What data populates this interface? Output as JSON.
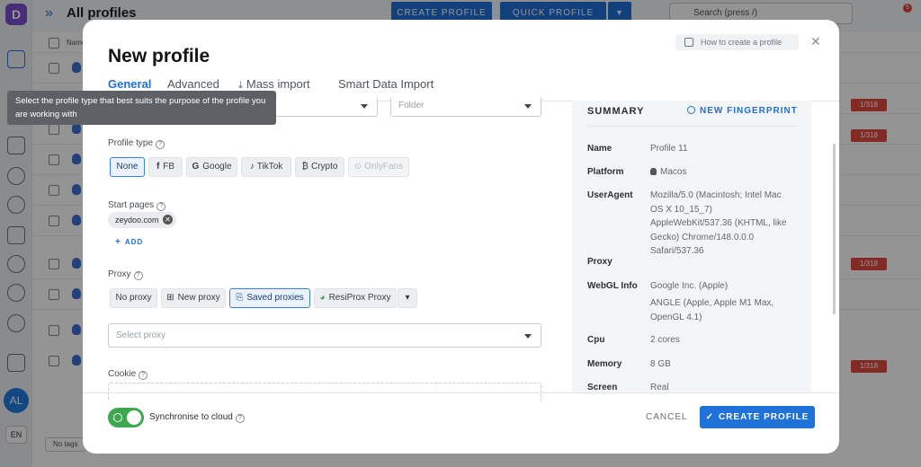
{
  "app": {
    "logo_letter": "D",
    "title": "All profiles",
    "create_profile_btn": "CREATE PROFILE",
    "quick_profile_btn": "QUICK PROFILE",
    "search_placeholder": "Search (press /)",
    "notification_count": "5",
    "user_initials": "AL",
    "language": "EN",
    "column_name": "Name",
    "limit_badge": "1/318",
    "tags_filter": "No tags"
  },
  "modal": {
    "title": "New profile",
    "how_to": "How to create a profile",
    "tabs": [
      {
        "label": "General",
        "active": true
      },
      {
        "label": "Advanced",
        "active": false
      },
      {
        "label": "Mass import",
        "active": false
      },
      {
        "label": "Smart Data Import",
        "active": false
      }
    ],
    "folder_placeholder": "Folder",
    "tooltip": "Select the profile type that best suits the purpose of the profile you are working with",
    "profile_type": {
      "label": "Profile type",
      "options": [
        {
          "label": "None",
          "icon": "",
          "selected": true,
          "disabled": false
        },
        {
          "label": "FB",
          "icon": "f",
          "selected": false,
          "disabled": false
        },
        {
          "label": "Google",
          "icon": "G",
          "selected": false,
          "disabled": false
        },
        {
          "label": "TikTok",
          "icon": "♪",
          "selected": false,
          "disabled": false
        },
        {
          "label": "Crypto",
          "icon": "₿",
          "selected": false,
          "disabled": false
        },
        {
          "label": "OnlyFans",
          "icon": "⊙",
          "selected": false,
          "disabled": true
        }
      ]
    },
    "start_pages": {
      "label": "Start pages",
      "chips": [
        "zeydoo.com"
      ],
      "add_label": "ADD"
    },
    "proxy": {
      "label": "Proxy",
      "options": [
        "No proxy",
        "New proxy",
        "Saved proxies",
        "ResiProx Proxy"
      ],
      "selected": "Saved proxies",
      "select_placeholder": "Select proxy"
    },
    "cookie": {
      "label": "Cookie"
    },
    "summary": {
      "title": "SUMMARY",
      "new_fingerprint": "NEW FINGERPRINT",
      "rows": [
        {
          "key": "Name",
          "value": "Profile 11"
        },
        {
          "key": "Platform",
          "value": "Macos"
        },
        {
          "key": "UserAgent",
          "value": "Mozilla/5.0 (Macintosh; Intel Mac OS X 10_15_7) AppleWebKit/537.36 (KHTML, like Gecko) Chrome/148.0.0.0 Safari/537.36"
        },
        {
          "key": "Proxy",
          "value": ""
        },
        {
          "key": "WebGL Info",
          "value": "Google Inc. (Apple)"
        },
        {
          "key": "",
          "value": "ANGLE (Apple, Apple M1 Max, OpenGL 4.1)"
        },
        {
          "key": "Cpu",
          "value": "2 cores"
        },
        {
          "key": "Memory",
          "value": "8 GB"
        },
        {
          "key": "Screen",
          "value": "Real"
        }
      ]
    },
    "footer": {
      "sync_label": "Synchronise to cloud",
      "sync_enabled": true,
      "cancel": "CANCEL",
      "create": "CREATE PROFILE"
    }
  },
  "colors": {
    "primary": "#1f6fd6",
    "toggle_on": "#3ea84e",
    "danger": "#e4493f"
  }
}
